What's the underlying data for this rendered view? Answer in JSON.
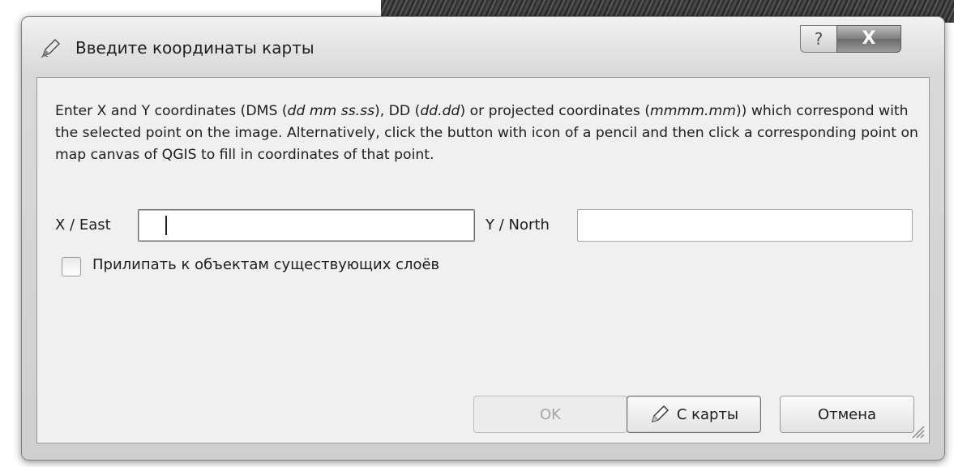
{
  "window": {
    "title": "Введите координаты карты",
    "help_label": "?",
    "close_label": "X"
  },
  "description": {
    "p1": "Enter X and Y coordinates (DMS (",
    "dms_fmt": "dd mm ss.ss",
    "p2": "), DD (",
    "dd_fmt": "dd.dd",
    "p3": ") or projected coordinates (",
    "proj_fmt": "mmmm.mm",
    "p4": ")) which correspond with the selected point on the image. Alternatively, click the button with icon of a pencil and then click a corresponding point on map canvas of QGIS to fill in coordinates of that point."
  },
  "fields": {
    "x_label": "X / East",
    "x_value": "",
    "y_label": "Y / North",
    "y_value": ""
  },
  "snap_checkbox": {
    "label": "Прилипать к объектам существующих слоёв",
    "checked": false
  },
  "buttons": {
    "ok": "OK",
    "from_map": "С карты",
    "cancel": "Отмена"
  },
  "icons": {
    "app": "pencil-georef-icon",
    "from_map": "pencil-icon",
    "resize": "resize-grip-icon"
  }
}
